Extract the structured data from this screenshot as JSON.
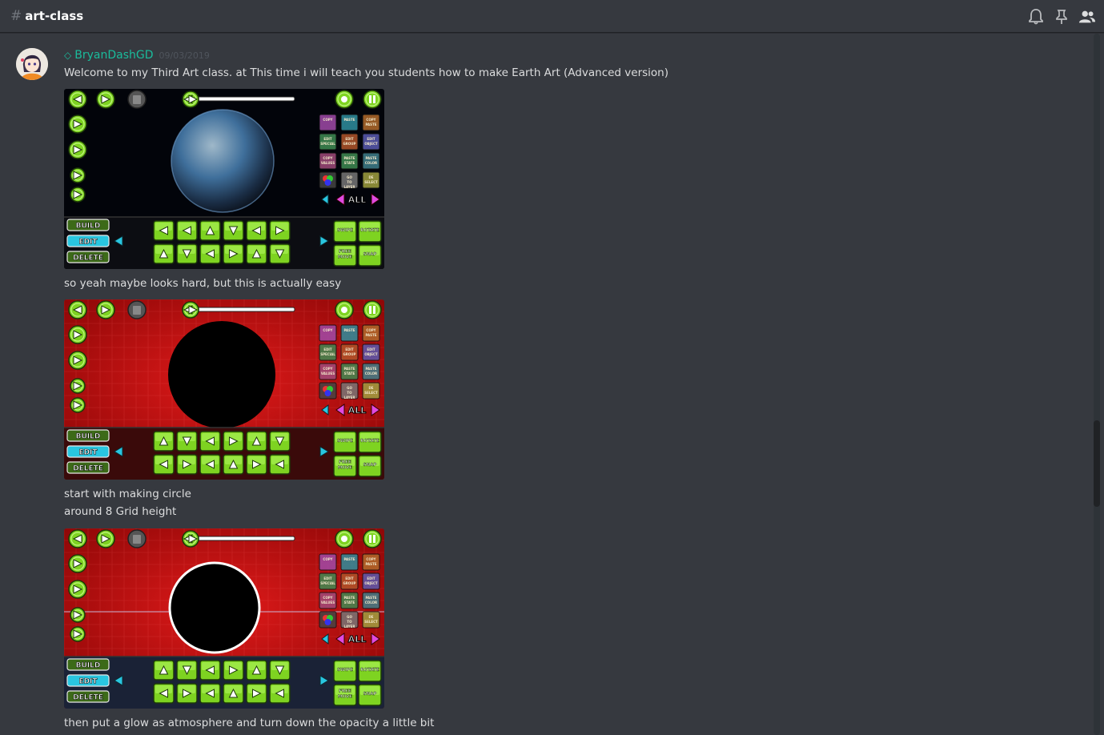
{
  "channel": {
    "hash": "#",
    "name": "art-class"
  },
  "header_icons": [
    "bell-icon",
    "pin-icon",
    "members-icon"
  ],
  "message": {
    "username": "BryanDashGD",
    "timestamp": "09/03/2019",
    "text1": "Welcome to my Third Art class. at This time i will teach you students how to make Earth Art (Advanced version)",
    "text2": "so yeah maybe looks hard, but this is actually easy",
    "text3a": "start with making circle",
    "text3b": "around 8 Grid height",
    "text4": "then put a glow as atmosphere and turn down the opacity a little bit"
  },
  "editor": {
    "build": "BUILD",
    "edit": "EDIT",
    "delete": "DELETE",
    "all": "ALL",
    "swipe": "SWIPE",
    "rotate": "ROTATE",
    "free_move": "FREE MOVE",
    "snap": "SNAP",
    "panel_labels": [
      "COPY",
      "PASTE",
      "COPY PASTE",
      "EDIT SPECIAL",
      "EDIT GROUP",
      "EDIT OBJECT",
      "COPY VALUES",
      "PASTE STATE",
      "PASTE COLOR",
      "",
      "GO TO LAYER",
      "DE SELECT"
    ]
  },
  "colors": {
    "accent": "#1abc9c",
    "bg": "#36393f",
    "button_green": "#7ed321",
    "edit_cyan": "#29c6e0"
  }
}
